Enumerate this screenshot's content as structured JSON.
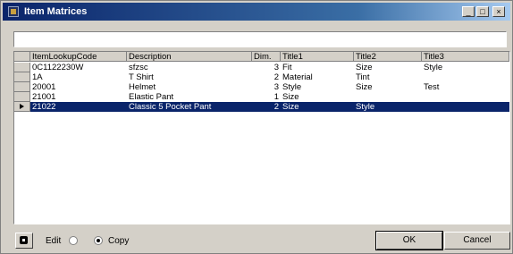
{
  "window": {
    "title": "Item Matrices",
    "minimize": "_",
    "maximize": "□",
    "close": "×"
  },
  "filter": {
    "value": ""
  },
  "grid": {
    "columns": [
      "ItemLookupCode",
      "Description",
      "Dim.",
      "Title1",
      "Title2",
      "Title3"
    ],
    "rows": [
      {
        "code": "0C1122230W",
        "description": "sfzsc",
        "dim": "3",
        "title1": "Fit",
        "title2": "Size",
        "title3": "Style"
      },
      {
        "code": "1A",
        "description": "T Shirt",
        "dim": "2",
        "title1": "Material",
        "title2": "Tint",
        "title3": ""
      },
      {
        "code": "20001",
        "description": "Helmet",
        "dim": "3",
        "title1": "Style",
        "title2": "Size",
        "title3": "Test"
      },
      {
        "code": "21001",
        "description": "Elastic Pant",
        "dim": "1",
        "title1": "Size",
        "title2": "",
        "title3": ""
      },
      {
        "code": "21022",
        "description": "Classic 5 Pocket Pant",
        "dim": "2",
        "title1": "Size",
        "title2": "Style",
        "title3": ""
      }
    ],
    "selected_row_index": 4
  },
  "options": {
    "edit_label": "Edit",
    "copy_label": "Copy",
    "selected": "Copy"
  },
  "buttons": {
    "ok": "OK",
    "cancel": "Cancel"
  },
  "colors": {
    "title_start": "#0a246a",
    "selection": "#0a246a",
    "face": "#d4d0c8"
  }
}
